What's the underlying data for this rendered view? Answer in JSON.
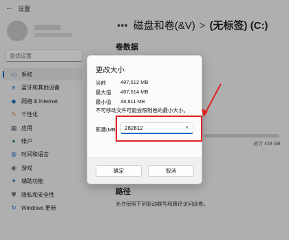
{
  "window": {
    "back_arrow": "←",
    "app_title": "设置"
  },
  "search": {
    "placeholder": "查找设置"
  },
  "sidebar": {
    "items": [
      {
        "label": "系统",
        "icon": "monitor-icon",
        "glyph": "▭",
        "color": "#2b79d0",
        "selected": true
      },
      {
        "label": "蓝牙和其他设备",
        "icon": "bluetooth-icon",
        "glyph": "ʙ",
        "color": "#2b79d0"
      },
      {
        "label": "网络 & Internet",
        "icon": "wifi-icon",
        "glyph": "◆",
        "color": "#1f6fb8"
      },
      {
        "label": "个性化",
        "icon": "brush-icon",
        "glyph": "✎",
        "color": "#d08a2b"
      },
      {
        "label": "应用",
        "icon": "apps-icon",
        "glyph": "▦",
        "color": "#5b6b7a"
      },
      {
        "label": "帐户",
        "icon": "account-icon",
        "glyph": "●",
        "color": "#2e9a6a"
      },
      {
        "label": "时间和语言",
        "icon": "globe-icon",
        "glyph": "◍",
        "color": "#2b79d0"
      },
      {
        "label": "游戏",
        "icon": "gamepad-icon",
        "glyph": "◉",
        "color": "#6c6c6c"
      },
      {
        "label": "辅助功能",
        "icon": "accessibility-icon",
        "glyph": "✦",
        "color": "#2b79d0"
      },
      {
        "label": "隐私和安全性",
        "icon": "shield-icon",
        "glyph": "⛊",
        "color": "#7a7a7a"
      },
      {
        "label": "Windows 更新",
        "icon": "update-icon",
        "glyph": "↻",
        "color": "#2b79d0"
      }
    ]
  },
  "breadcrumb": {
    "sep1": "•••",
    "disk": "磁盘和卷(&V)",
    "sep2": ">",
    "current": "(无标签) (C:)"
  },
  "main": {
    "volume_heading": "卷数据",
    "total": "总计 428 GB",
    "path_heading": "路径",
    "path_desc": "允许使用下列驱动器号和路径访问此卷。",
    "usage_fraction": 0.0
  },
  "dialog": {
    "title": "更改大小",
    "rows": [
      {
        "label": "当前",
        "value": "487,612 MB"
      },
      {
        "label": "最大值",
        "value": "487,614 MB"
      },
      {
        "label": "最小值",
        "value": "48,811 MB"
      }
    ],
    "warning": "不可移动文件可能会限制卷的最小大小。",
    "new_size_label": "新建(MB):",
    "new_size_value": "282812",
    "clear_glyph": "×",
    "ok_label": "确定",
    "cancel_label": "取消"
  },
  "annotation": {
    "highlight_color": "#e02020"
  }
}
